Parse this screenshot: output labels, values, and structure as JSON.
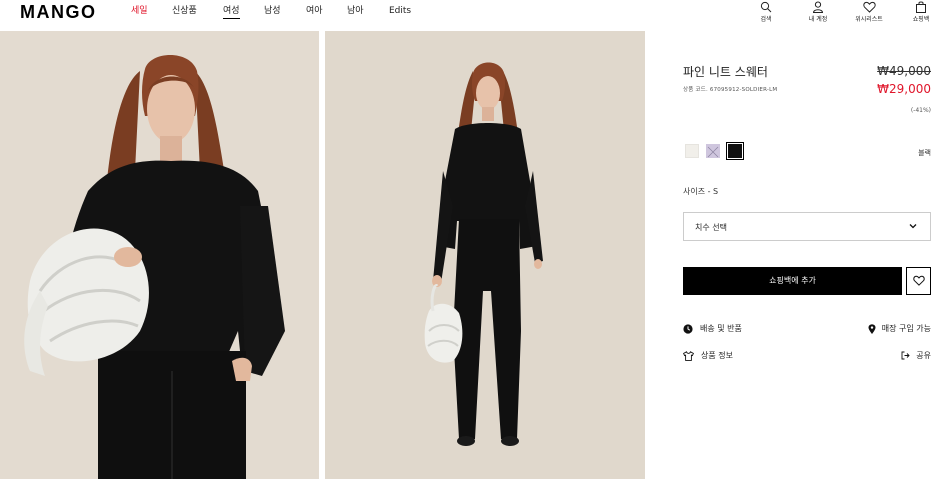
{
  "header": {
    "logo": "MANGO",
    "nav": [
      {
        "label": "세일",
        "state": "sale"
      },
      {
        "label": "신상품",
        "state": ""
      },
      {
        "label": "여성",
        "state": "active"
      },
      {
        "label": "남성",
        "state": ""
      },
      {
        "label": "여아",
        "state": ""
      },
      {
        "label": "남아",
        "state": ""
      },
      {
        "label": "Edits",
        "state": ""
      }
    ],
    "icons": [
      {
        "icon": "search-icon",
        "label": "검색"
      },
      {
        "icon": "user-icon",
        "label": "내 계정"
      },
      {
        "icon": "heart-icon",
        "label": "위시리스트"
      },
      {
        "icon": "bag-icon",
        "label": "쇼핑백"
      }
    ]
  },
  "product": {
    "name": "파인 니트 스웨터",
    "code": "상품 코드. 67095912-SOLDIER-LM",
    "old_price": "₩49,000",
    "new_price": "₩29,000",
    "discount": "(-41%)",
    "colors": [
      {
        "name": "white",
        "hex": "#f1efea"
      },
      {
        "name": "lilac",
        "hex": "#cfc6de"
      },
      {
        "name": "black",
        "hex": "#111111"
      }
    ],
    "selected_color": "블랙",
    "size_label": "사이즈 - S",
    "size_select_placeholder": "치수 선택",
    "add_to_bag": "쇼핑백에 추가",
    "links": {
      "shipping": "배송 및 반품",
      "store": "매장 구입 가능",
      "details": "상품 정보",
      "share": "공유"
    }
  },
  "colors": {
    "sale": "#e0162b",
    "photo_bg": "#e3dbd0",
    "button": "#000000"
  }
}
